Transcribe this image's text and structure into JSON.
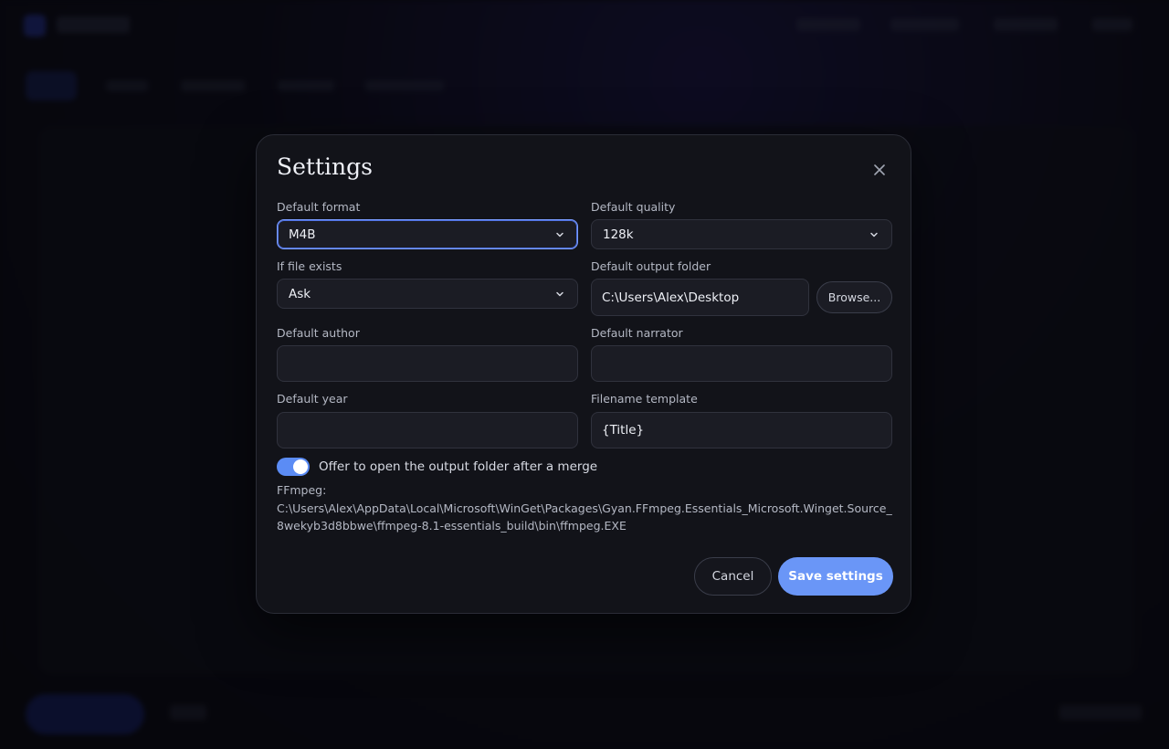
{
  "dialog": {
    "title": "Settings",
    "close_icon": "close-icon"
  },
  "fields": {
    "default_format": {
      "label": "Default format",
      "value": "M4B"
    },
    "default_quality": {
      "label": "Default quality",
      "value": "128k"
    },
    "if_file_exists": {
      "label": "If file exists",
      "value": "Ask"
    },
    "default_output_folder": {
      "label": "Default output folder",
      "value": "C:\\Users\\Alex\\Desktop"
    },
    "default_author": {
      "label": "Default author",
      "value": ""
    },
    "default_narrator": {
      "label": "Default narrator",
      "value": ""
    },
    "default_year": {
      "label": "Default year",
      "value": ""
    },
    "filename_template": {
      "label": "Filename template",
      "value": "{Title}"
    }
  },
  "browse_label": "Browse...",
  "toggle": {
    "label": "Offer to open the output folder after a merge",
    "on": true
  },
  "ffmpeg": {
    "label": "FFmpeg:",
    "path": "C:\\Users\\Alex\\AppData\\Local\\Microsoft\\WinGet\\Packages\\Gyan.FFmpeg.Essentials_Microsoft.Winget.Source_8wekyb3d8bbwe\\ffmpeg-8.1-essentials_build\\bin\\ffmpeg.EXE"
  },
  "actions": {
    "cancel_label": "Cancel",
    "save_label": "Save settings"
  },
  "colors": {
    "accent": "#6a96f7",
    "focus_border": "#7a9cff",
    "dialog_bg": "#121319"
  }
}
